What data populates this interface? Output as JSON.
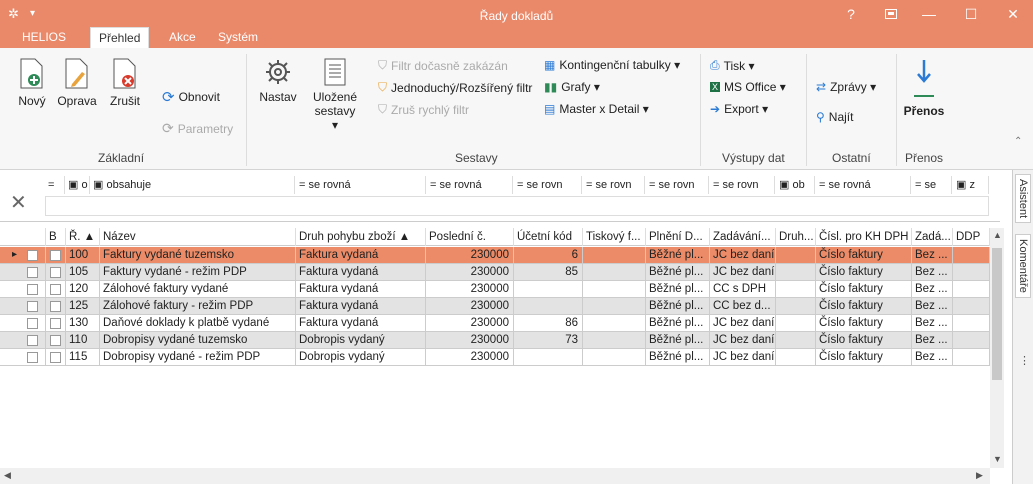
{
  "window": {
    "title": "Řady dokladů",
    "help": "?",
    "colors": {
      "accent": "#e9896a",
      "selected_row": "#eb8b67",
      "alt_row": "#e3e3e3"
    }
  },
  "tabs": [
    {
      "label": "HELIOS"
    },
    {
      "label": "Přehled"
    },
    {
      "label": "Akce"
    },
    {
      "label": "Systém"
    }
  ],
  "ribbon": {
    "zakladni": {
      "label": "Základní",
      "novy": "Nový",
      "oprava": "Oprava",
      "zrusit": "Zrušit",
      "obnovit": "Obnovit",
      "parametry": "Parametry"
    },
    "sestavy": {
      "label": "Sestavy",
      "nastav": "Nastav",
      "ulozene": "Uložené",
      "ulozene2": "sestavy ▾",
      "filtr_docasne": "Filtr dočasně zakázán",
      "jednoduchy": "Jednoduchý/Rozšířený filtr",
      "zrus_filtr": "Zruš rychlý filtr",
      "kontingencni": "Kontingenční tabulky ▾",
      "grafy": "Grafy ▾",
      "master": "Master x Detail ▾"
    },
    "vystupy": {
      "label": "Výstupy dat",
      "tisk": "Tisk ▾",
      "msoffice": "MS Office ▾",
      "export": "Export ▾"
    },
    "ostatni": {
      "label": "Ostatní",
      "zpravy": "Zprávy ▾",
      "najit": "Najít"
    },
    "prenos": {
      "label": "Přenos",
      "button": "Přenos"
    }
  },
  "filters": [
    "o",
    "obsahuje",
    "= se rovná",
    "= se rovná",
    "= se rovn",
    "= se rovn",
    "= se rovn",
    "= se rovn",
    "ob",
    "= se rovná",
    "= se",
    "z"
  ],
  "columns": [
    "B",
    "Ř. ▲",
    "Název",
    "Druh pohybu zboží ▲",
    "Poslední č.",
    "Účetní kód",
    "Tiskový f...",
    "Plnění D...",
    "Zadávání...",
    "Druh...",
    "Čísl. pro KH DPH",
    "Zadá...",
    "DDP"
  ],
  "rows": [
    {
      "r": "100",
      "nazev": "Faktury vydané tuzemsko",
      "druh": "Faktura vydaná",
      "posledni": "230000",
      "ucetni": "6",
      "tisk": "",
      "plneni": "Běžné pl...",
      "zadavani": "JC bez daní",
      "druh2": "",
      "kh": "Číslo faktury",
      "zada": "Bez ...",
      "ddp": ""
    },
    {
      "r": "105",
      "nazev": "Faktury vydané - režim PDP",
      "druh": "Faktura vydaná",
      "posledni": "230000",
      "ucetni": "85",
      "tisk": "",
      "plneni": "Běžné pl...",
      "zadavani": "JC bez daní",
      "druh2": "",
      "kh": "Číslo faktury",
      "zada": "Bez ...",
      "ddp": ""
    },
    {
      "r": "120",
      "nazev": "Zálohové faktury vydané",
      "druh": "Faktura vydaná",
      "posledni": "230000",
      "ucetni": "",
      "tisk": "",
      "plneni": "Běžné pl...",
      "zadavani": "CC s DPH",
      "druh2": "",
      "kh": "Číslo faktury",
      "zada": "Bez ...",
      "ddp": ""
    },
    {
      "r": "125",
      "nazev": "Zálohové faktury - režim PDP",
      "druh": "Faktura vydaná",
      "posledni": "230000",
      "ucetni": "",
      "tisk": "",
      "plneni": "Běžné pl...",
      "zadavani": "CC bez d...",
      "druh2": "",
      "kh": "Číslo faktury",
      "zada": "Bez ...",
      "ddp": ""
    },
    {
      "r": "130",
      "nazev": "Daňové doklady k platbě vydané",
      "druh": "Faktura vydaná",
      "posledni": "230000",
      "ucetni": "86",
      "tisk": "",
      "plneni": "Běžné pl...",
      "zadavani": "JC bez daní",
      "druh2": "",
      "kh": "Číslo faktury",
      "zada": "Bez ...",
      "ddp": ""
    },
    {
      "r": "110",
      "nazev": "Dobropisy vydané tuzemsko",
      "druh": "Dobropis vydaný",
      "posledni": "230000",
      "ucetni": "73",
      "tisk": "",
      "plneni": "Běžné pl...",
      "zadavani": "JC bez daní",
      "druh2": "",
      "kh": "Číslo faktury",
      "zada": "Bez ...",
      "ddp": ""
    },
    {
      "r": "115",
      "nazev": "Dobropisy vydané - režim PDP",
      "druh": "Dobropis vydaný",
      "posledni": "230000",
      "ucetni": "",
      "tisk": "",
      "plneni": "Běžné pl...",
      "zadavani": "JC bez daní",
      "druh2": "",
      "kh": "Číslo faktury",
      "zada": "Bez ...",
      "ddp": ""
    }
  ],
  "sidepanel": [
    "Asistent",
    "Komentáře"
  ]
}
